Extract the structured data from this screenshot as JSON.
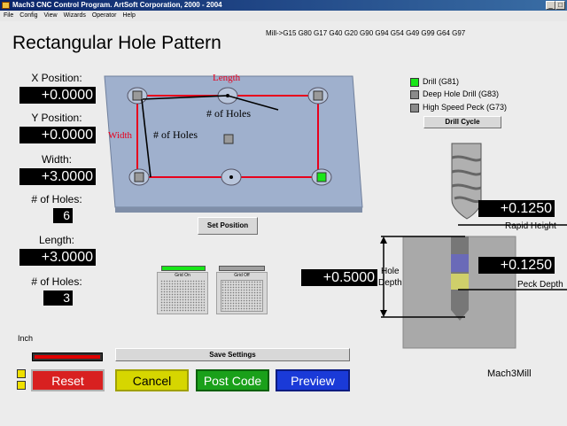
{
  "window": {
    "title": "Mach3 CNC Control Program. ArtSoft Corporation, 2000 - 2004"
  },
  "menu": [
    "File",
    "Config",
    "View",
    "Wizards",
    "Operator",
    "Help"
  ],
  "page": {
    "title": "Rectangular Hole Pattern",
    "gcodes": "Mill->G15  G80 G17 G40 G20 G90 G94 G54 G49 G99 G64 G97"
  },
  "fields": {
    "x_position": {
      "label": "X Position:",
      "value": "+0.0000"
    },
    "y_position": {
      "label": "Y Position:",
      "value": "+0.0000"
    },
    "width": {
      "label": "Width:",
      "value": "+3.0000"
    },
    "holes_width": {
      "label": "# of Holes:",
      "value": "6"
    },
    "length": {
      "label": "Length:",
      "value": "+3.0000"
    },
    "holes_length": {
      "label": "# of Holes:",
      "value": "3"
    }
  },
  "diagram": {
    "length_label": "Length",
    "width_label": "Width",
    "holes_top": "# of Holes",
    "holes_left": "# of Holes",
    "colors": {
      "plate": "#9fb0cd",
      "rect": "#e8001c",
      "active_hole": "#19e619"
    }
  },
  "set_position_label": "Set Position",
  "grid": {
    "on_label": "Grid On",
    "off_label": "Grid Off"
  },
  "drill_options": [
    {
      "label": "Drill (G81)",
      "active": true
    },
    {
      "label": "Deep Hole Drill (G83)",
      "active": false
    },
    {
      "label": "High Speed Peck (G73)",
      "active": false
    }
  ],
  "drill_cycle_label": "Drill Cycle",
  "rapid_height": {
    "value": "+0.1250",
    "label": "Rapid Height"
  },
  "hole_depth": {
    "value": "+0.5000",
    "label_line1": "Hole",
    "label_line2": "Depth"
  },
  "peck_depth": {
    "value": "+0.1250",
    "label": "Peck Depth"
  },
  "units": "Inch",
  "save_settings_label": "Save Settings",
  "buttons": {
    "reset": "Reset",
    "cancel": "Cancel",
    "post_code": "Post Code",
    "preview": "Preview"
  },
  "brand": "Mach3Mill"
}
